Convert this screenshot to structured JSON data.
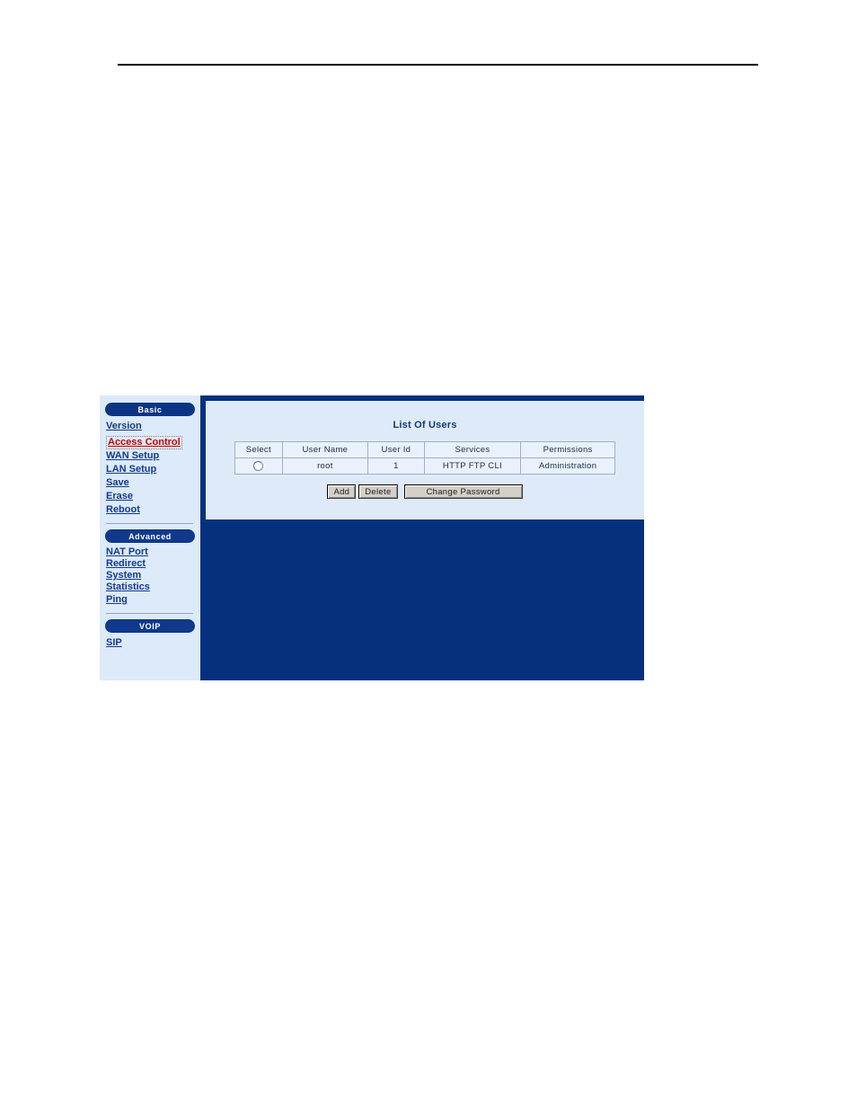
{
  "sidebar": {
    "sections": [
      {
        "pill_label": "Basic",
        "pill_name": "nav-section-basic",
        "items": [
          {
            "label": "Version",
            "name": "sidebar-item-version",
            "active": false
          },
          {
            "label": "Access Control",
            "name": "sidebar-item-access-control",
            "active": true
          },
          {
            "label": "WAN Setup",
            "name": "sidebar-item-wan-setup",
            "active": false
          },
          {
            "label": "LAN Setup",
            "name": "sidebar-item-lan-setup",
            "active": false
          },
          {
            "label": "Save",
            "name": "sidebar-item-save",
            "active": false
          },
          {
            "label": "Erase",
            "name": "sidebar-item-erase",
            "active": false
          },
          {
            "label": "Reboot",
            "name": "sidebar-item-reboot",
            "active": false
          }
        ]
      },
      {
        "pill_label": "Advanced",
        "pill_name": "nav-section-advanced",
        "items": [
          {
            "label": "NAT Port",
            "label2": "Redirect",
            "name": "sidebar-item-nat-port-redirect",
            "active": false
          },
          {
            "label": "System",
            "label2": "Statistics",
            "name": "sidebar-item-system-statistics",
            "active": false
          },
          {
            "label": "Ping",
            "name": "sidebar-item-ping",
            "active": false
          }
        ]
      },
      {
        "pill_label": "VOIP",
        "pill_name": "nav-section-voip",
        "items": [
          {
            "label": "SIP",
            "name": "sidebar-item-sip",
            "active": false
          }
        ]
      }
    ]
  },
  "panel": {
    "title": "List Of Users",
    "table": {
      "headers": [
        "Select",
        "User Name",
        "User Id",
        "Services",
        "Permissions"
      ],
      "rows": [
        {
          "select": "",
          "user_name": "root",
          "user_id": "1",
          "services": "HTTP FTP CLI",
          "permissions": "Administration"
        }
      ]
    },
    "buttons": {
      "add": "Add",
      "delete": "Delete",
      "change_password": "Change Password"
    }
  },
  "colors": {
    "sidebar_bg": "#dceaf9",
    "pill_bg": "#0b3583",
    "content_bg": "#04307e",
    "panel_bg": "#dfeaf9",
    "link": "#143a8c",
    "active_link": "#cc0000",
    "title": "#123a72",
    "button_face": "#d4d0c8"
  }
}
